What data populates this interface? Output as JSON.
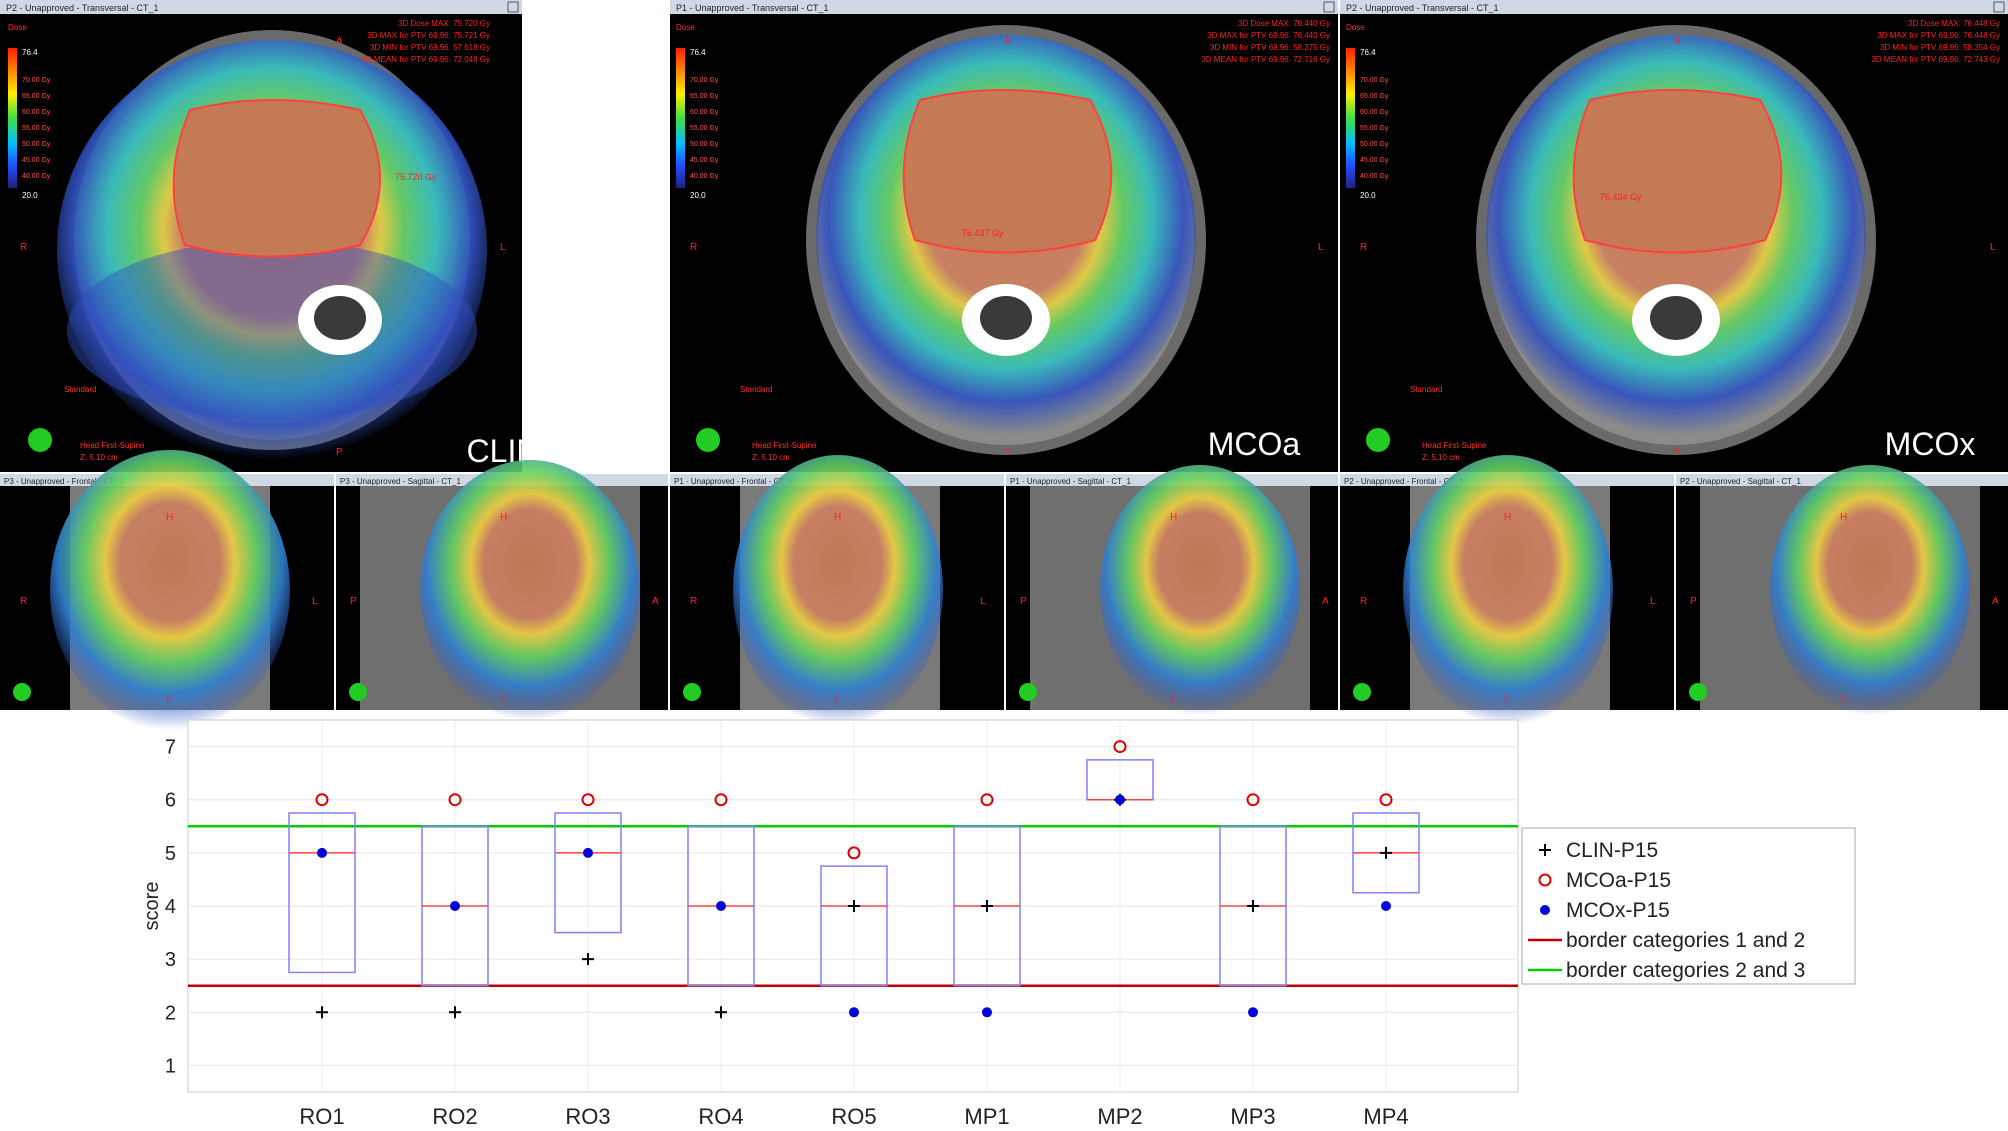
{
  "viewer": {
    "headers": [
      "P2 - Unapproved - Transversal - CT_1",
      "P1 - Unapproved - Transversal - CT_1",
      "P2 - Unapproved - Transversal - CT_1",
      "P3 - Unapproved - Frontal - CT_1",
      "P3 - Unapproved - Sagittal - CT_1",
      "P1 - Unapproved - Frontal - CT_1",
      "P1 - Unapproved - Sagittal - CT_1",
      "P2 - Unapproved - Frontal - CT_1",
      "P2 - Unapproved - Sagittal - CT_1"
    ],
    "plan_labels": [
      "CLIN",
      "MCOa",
      "MCOx"
    ],
    "dose_stats": [
      [
        "3D Dose MAX: 75.720 Gy",
        "3D MAX for PTV 69.96: 75.721 Gy",
        "3D MIN for PTV 69.96: 57.618 Gy",
        "3D MEAN for PTV 69.96: 72.048 Gy"
      ],
      [
        "3D Dose MAX: 76.440 Gy",
        "3D MAX for PTV 69.96: 76.440 Gy",
        "3D MIN for PTV 69.96: 58.375 Gy",
        "3D MEAN for PTV 69.96: 72.716 Gy"
      ],
      [
        "3D Dose MAX: 76.448 Gy",
        "3D MAX for PTV 69.96: 76.448 Gy",
        "3D MIN for PTV 69.96: 58.354 Gy",
        "3D MEAN for PTV 69.96: 72.743 Gy"
      ]
    ],
    "point_doses": [
      "75.720 Gy",
      "76.437 Gy",
      "76.434 Gy"
    ],
    "colorbar": {
      "title": "Dose",
      "top_value": "76.4",
      "levels": [
        "70.00 Gy",
        "65.00 Gy",
        "60.00 Gy",
        "55.00 Gy",
        "50.00 Gy",
        "45.00 Gy",
        "40.00 Gy"
      ],
      "bottom_value": "20.0"
    },
    "orientation": {
      "anterior": "A",
      "right": "R",
      "left": "L",
      "posterior": "P",
      "head": "H",
      "feet": "F"
    },
    "standard_label": "Standard",
    "position_label": "Head First-Supine",
    "slice_label": "Z: 5.10 cm"
  },
  "chart_data": {
    "type": "box",
    "ylabel": "score",
    "ylim": [
      0.5,
      7.5
    ],
    "yticks": [
      1,
      2,
      3,
      4,
      5,
      6,
      7
    ],
    "grid": true,
    "legend_position": "right",
    "categories": [
      "RO1",
      "RO2",
      "RO3",
      "RO4",
      "RO5",
      "MP1",
      "MP2",
      "MP3",
      "MP4"
    ],
    "series": [
      {
        "name": "CLIN-P15",
        "marker": "plus",
        "color": "#000000",
        "values": [
          2,
          2,
          3,
          2,
          4,
          4,
          6,
          4,
          5
        ]
      },
      {
        "name": "MCOa-P15",
        "marker": "open-circle",
        "color": "#dd0000",
        "values": [
          6,
          6,
          6,
          6,
          5,
          6,
          7,
          6,
          6
        ]
      },
      {
        "name": "MCOx-P15",
        "marker": "dot",
        "color": "#0000dd",
        "values": [
          5,
          4,
          5,
          4,
          2,
          2,
          6,
          2,
          4
        ]
      }
    ],
    "boxes": [
      {
        "q1": 2.75,
        "median": 5,
        "q3": 5.75
      },
      {
        "q1": 2.5,
        "median": 4,
        "q3": 5.5
      },
      {
        "q1": 3.5,
        "median": 5,
        "q3": 5.75
      },
      {
        "q1": 2.5,
        "median": 4,
        "q3": 5.5
      },
      {
        "q1": 2.5,
        "median": 4,
        "q3": 4.75
      },
      {
        "q1": 2.5,
        "median": 4,
        "q3": 5.5
      },
      {
        "q1": 6,
        "median": 6,
        "q3": 6.75
      },
      {
        "q1": 2.5,
        "median": 4,
        "q3": 5.5
      },
      {
        "q1": 4.25,
        "median": 5,
        "q3": 5.75
      }
    ],
    "hlines": [
      {
        "name": "border categories 1 and 2",
        "y": 2.5,
        "color": "#c00000"
      },
      {
        "name": "border categories 2 and 3",
        "y": 5.5,
        "color": "#00cc00"
      }
    ]
  }
}
